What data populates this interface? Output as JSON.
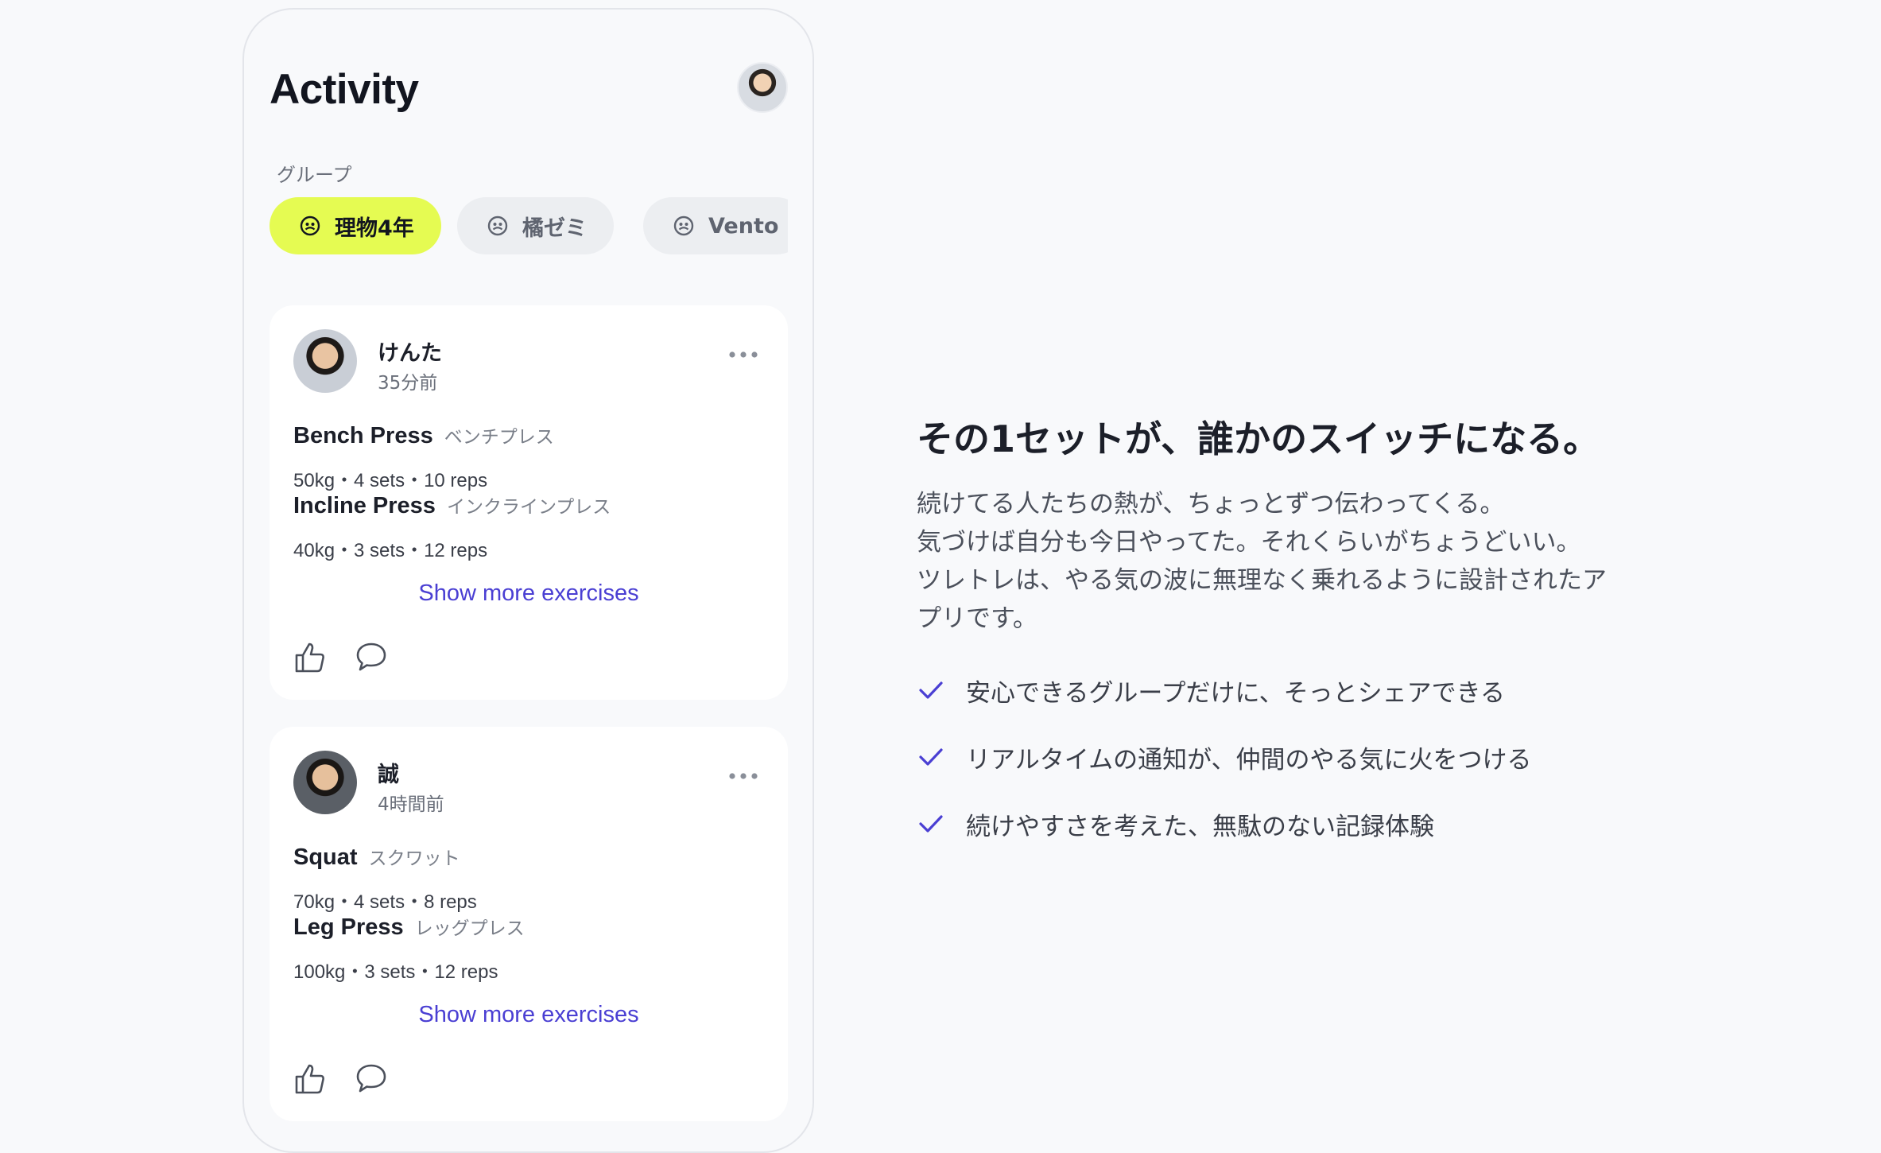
{
  "app": {
    "title": "Activity",
    "group_label": "グループ",
    "groups": [
      {
        "label": "理物4年",
        "active": true
      },
      {
        "label": "橘ゼミ",
        "active": false
      },
      {
        "label": "Vento",
        "active": false
      }
    ]
  },
  "posts": [
    {
      "user": "けんた",
      "time": "35分前",
      "exercises": [
        {
          "name": "Bench Press",
          "name_ja": "ベンチプレス",
          "detail": "50kg・4 sets・10 reps"
        },
        {
          "name": "Incline Press",
          "name_ja": "インクラインプレス",
          "detail": "40kg・3 sets・12 reps"
        }
      ],
      "show_more": "Show more exercises"
    },
    {
      "user": "誠",
      "time": "4時間前",
      "exercises": [
        {
          "name": "Squat",
          "name_ja": "スクワット",
          "detail": "70kg・4 sets・8 reps"
        },
        {
          "name": "Leg Press",
          "name_ja": "レッグプレス",
          "detail": "100kg・3 sets・12 reps"
        }
      ],
      "show_more": "Show more exercises"
    }
  ],
  "promo": {
    "headline": "その1セットが、誰かのスイッチになる。",
    "body_lines": [
      "続けてる人たちの熱が、ちょっとずつ伝わってくる。",
      "気づけば自分も今日やってた。それくらいがちょうどいい。",
      "ツレトレは、やる気の波に無理なく乗れるように設計されたア",
      "プリです。"
    ],
    "features": [
      "安心できるグループだけに、そっとシェアできる",
      "リアルタイムの通知が、仲間のやる気に火をつける",
      "続けやすさを考えた、無駄のない記録体験"
    ]
  },
  "colors": {
    "accent_chip": "#e5fb52",
    "link": "#4a3fd3",
    "check": "#4a3fd3"
  }
}
